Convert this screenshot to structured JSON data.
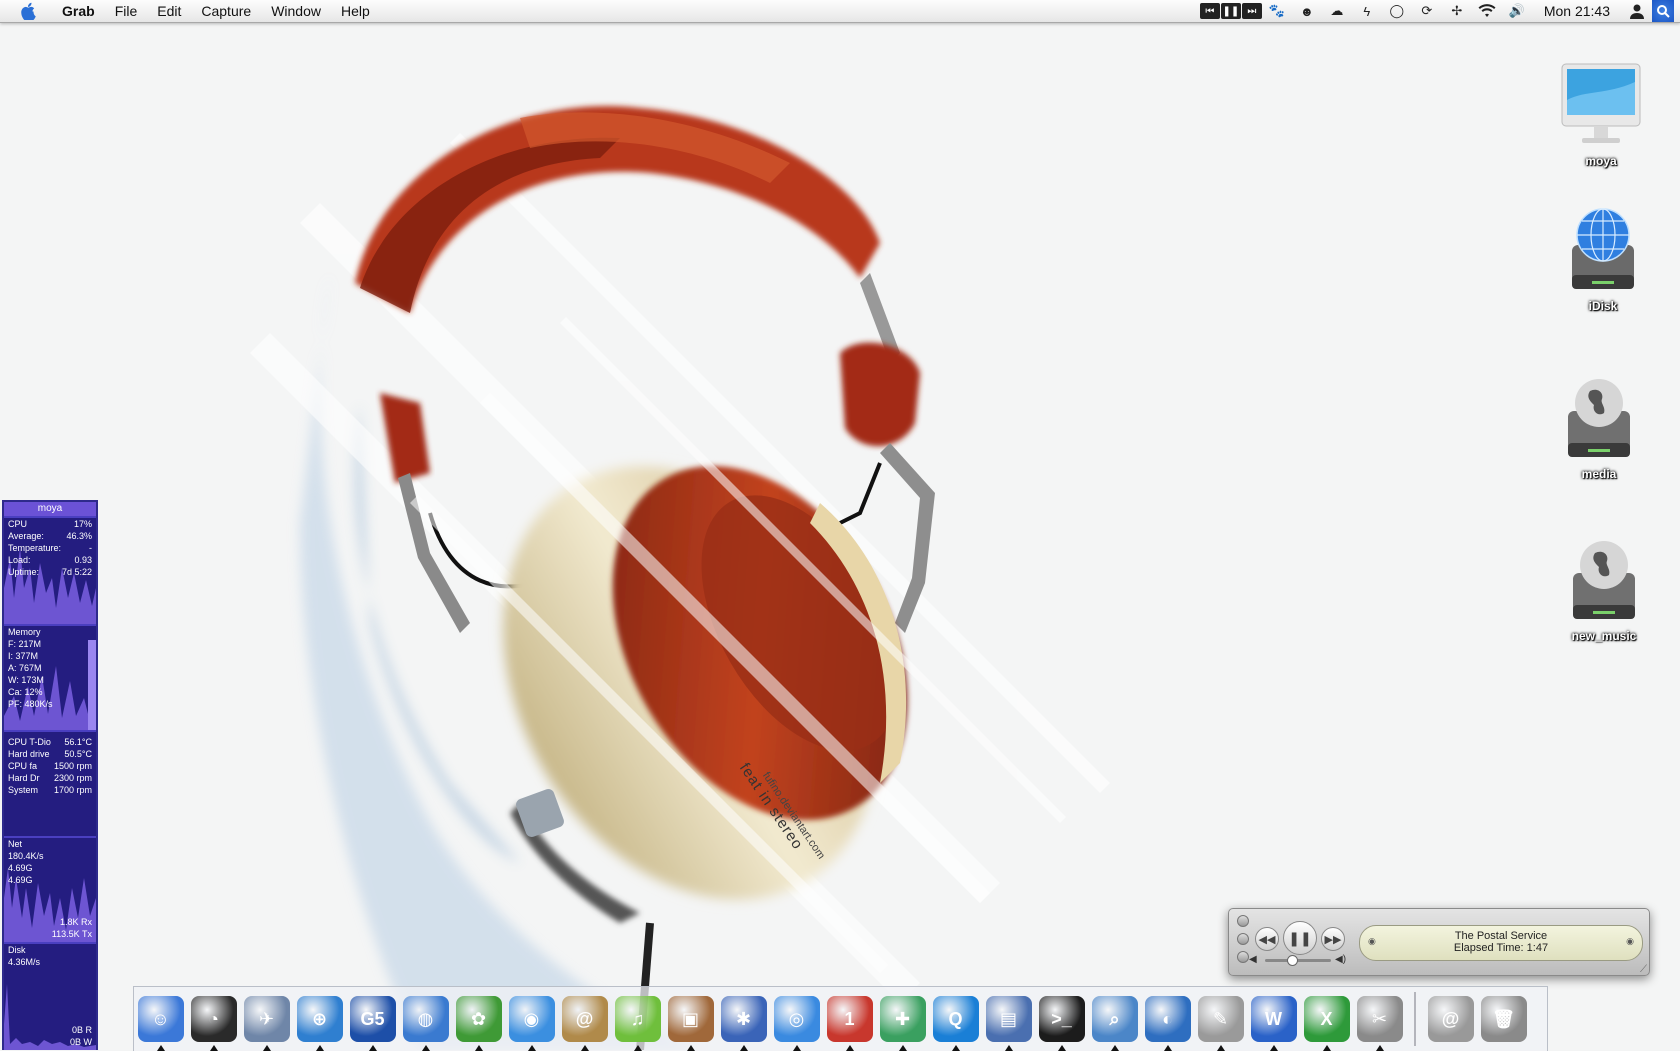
{
  "menubar": {
    "app_name": "Grab",
    "menus": [
      "File",
      "Edit",
      "Capture",
      "Window",
      "Help"
    ],
    "clock": "Mon 21:43"
  },
  "desktop_icons": [
    {
      "label": "moya",
      "icon": "computer-icon"
    },
    {
      "label": "iDisk",
      "icon": "idisk-icon"
    },
    {
      "label": "media",
      "icon": "network-disk-icon"
    },
    {
      "label": "new_music",
      "icon": "network-disk-icon"
    }
  ],
  "wallpaper": {
    "line1": "feat in stereo",
    "line2": "fufino.deviantart.com"
  },
  "sysmon": {
    "title": "moya",
    "cpu": [
      {
        "k": "CPU",
        "v": "17%"
      },
      {
        "k": "Average:",
        "v": "46.3%"
      },
      {
        "k": "Temperature:",
        "v": "-"
      },
      {
        "k": "Load:",
        "v": "0.93"
      },
      {
        "k": "Uptime:",
        "v": "7d 5:22"
      }
    ],
    "memory_title": "Memory",
    "memory": [
      "F: 217M",
      "I: 377M",
      "A: 767M",
      "W: 173M",
      "Ca: 12%",
      "PF: 480K/s"
    ],
    "sensors": [
      {
        "k": "CPU T-Dio",
        "v": "56.1°C"
      },
      {
        "k": "Hard drive",
        "v": "50.5°C"
      },
      {
        "k": "CPU fa",
        "v": "1500 rpm"
      },
      {
        "k": "Hard Dr",
        "v": "2300 rpm"
      },
      {
        "k": "System",
        "v": "1700 rpm"
      }
    ],
    "net_title": "Net",
    "net": [
      "180.4K/s",
      "4.69G",
      "4.69G"
    ],
    "net_rx": "1.8K Rx",
    "net_tx": "113.5K Tx",
    "disk_title": "Disk",
    "disk_rate": "4.36M/s",
    "disk_r": "0B R",
    "disk_w": "0B W"
  },
  "itunes": {
    "line1": "The Postal Service",
    "line2": "Elapsed Time: 1:47",
    "volume": 0.35
  },
  "dock": {
    "apps": [
      {
        "name": "Finder",
        "icon": "finder-icon",
        "color": "#3b78d8",
        "glyph": "☺"
      },
      {
        "name": "Dashboard",
        "icon": "dashboard-icon",
        "color": "#2a2a2a",
        "glyph": "◔"
      },
      {
        "name": "Mail",
        "icon": "mail-icon",
        "color": "#6f86a8",
        "glyph": "✈"
      },
      {
        "name": "Safari",
        "icon": "safari-icon",
        "color": "#2f7fd0",
        "glyph": "⊕"
      },
      {
        "name": "G5",
        "icon": "g5-icon",
        "color": "#1d4fa8",
        "glyph": "G5"
      },
      {
        "name": "Network",
        "icon": "network-globe-icon",
        "color": "#3a7ad0",
        "glyph": "◍"
      },
      {
        "name": "Adium",
        "icon": "adium-duck-icon",
        "color": "#3f9a36",
        "glyph": "✿"
      },
      {
        "name": "iChat",
        "icon": "ichat-icon",
        "color": "#3b8fe0",
        "glyph": "◉"
      },
      {
        "name": "Address Book",
        "icon": "address-book-icon",
        "color": "#b08a4a",
        "glyph": "@"
      },
      {
        "name": "iTunes",
        "icon": "itunes-icon",
        "color": "#6fbf3c",
        "glyph": "♫"
      },
      {
        "name": "iPhoto",
        "icon": "iphoto-icon",
        "color": "#a0683a",
        "glyph": "▣"
      },
      {
        "name": "iMovie",
        "icon": "imovie-icon",
        "color": "#3a64b8",
        "glyph": "✱"
      },
      {
        "name": "DVD Player",
        "icon": "dvd-icon",
        "color": "#3a8ae0",
        "glyph": "◎"
      },
      {
        "name": "iCal",
        "icon": "ical-icon",
        "color": "#c8372d",
        "glyph": "1"
      },
      {
        "name": "Camino",
        "icon": "camino-icon",
        "color": "#3aa060",
        "glyph": "✚"
      },
      {
        "name": "QuickTime",
        "icon": "quicktime-icon",
        "color": "#1a7fd6",
        "glyph": "Q"
      },
      {
        "name": "Preview",
        "icon": "preview-icon",
        "color": "#4a6fb0",
        "glyph": "▤"
      },
      {
        "name": "Terminal",
        "icon": "terminal-icon",
        "color": "#1c1c1c",
        "glyph": ">_"
      },
      {
        "name": "Sherlock",
        "icon": "magnifier-icon",
        "color": "#4b86c8",
        "glyph": "⌕"
      },
      {
        "name": "Network Utility",
        "icon": "network-utility-icon",
        "color": "#2e6ec0",
        "glyph": "◐"
      },
      {
        "name": "TextEdit",
        "icon": "textedit-icon",
        "color": "#9a9a9a",
        "glyph": "✎"
      },
      {
        "name": "Word",
        "icon": "word-icon",
        "color": "#2a62c8",
        "glyph": "W"
      },
      {
        "name": "Excel",
        "icon": "excel-icon",
        "color": "#2e9a3a",
        "glyph": "X"
      },
      {
        "name": "Utility",
        "icon": "scissors-icon",
        "color": "#8a8a8a",
        "glyph": "✂"
      }
    ],
    "right": [
      {
        "name": "Mail Server",
        "icon": "at-sign-icon",
        "color": "#999999",
        "glyph": "@"
      },
      {
        "name": "Trash",
        "icon": "trash-icon",
        "color": "#8a8a8a",
        "glyph": "🗑"
      }
    ],
    "running": [
      0,
      1,
      2,
      3,
      4,
      5,
      6,
      7,
      8,
      9,
      10,
      11,
      12,
      13,
      14,
      15,
      16,
      17,
      18,
      19,
      20,
      21,
      22,
      23
    ]
  }
}
